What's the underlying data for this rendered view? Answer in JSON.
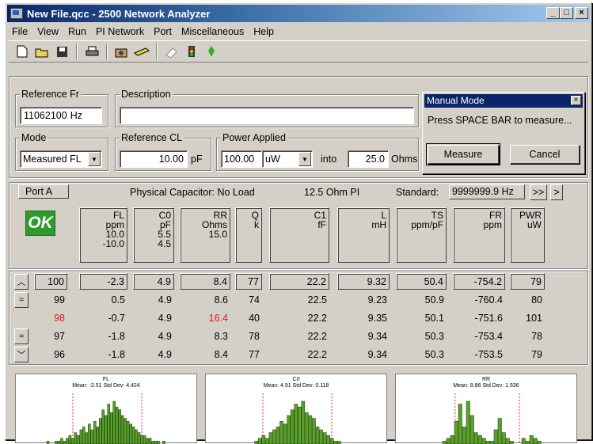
{
  "window": {
    "title": "New File.qcc - 2500 Network Analyzer",
    "buttons": {
      "min": "_",
      "max": "□",
      "close": "×"
    }
  },
  "menu": [
    "File",
    "View",
    "Run",
    "PI Network",
    "Port",
    "Miscellaneous",
    "Help"
  ],
  "toolbar": [
    "new-file-icon",
    "open-folder-icon",
    "save-icon",
    "print-icon",
    "camera-icon",
    "tape-icon",
    "eraser-icon",
    "traffic-light-icon",
    "pin-icon"
  ],
  "form": {
    "ref_freq_label": "Reference Fr",
    "ref_freq_value": "11062100",
    "ref_freq_unit": "Hz",
    "description_label": "Description",
    "description_value": "",
    "mode_label": "Mode",
    "mode_value": "Measured FL",
    "ref_cl_label": "Reference CL",
    "ref_cl_value": "10.00",
    "ref_cl_unit": "pF",
    "power_label": "Power Applied",
    "power_value": "100.00",
    "power_unit": "uW",
    "into_label": "into",
    "ohms_value": "25.0",
    "ohms_unit": "Ohms"
  },
  "manual": {
    "title": "Manual Mode",
    "message": "Press SPACE BAR to measure...",
    "measure": "Measure",
    "cancel": "Cancel",
    "close": "×"
  },
  "info": {
    "port": "Port A",
    "physical_cap": "Physical Capacitor: No Load",
    "pi": "12.5 Ohm PI",
    "standard_label": "Standard:",
    "standard_value": "9999999.9 Hz",
    "next_all": ">>",
    "next": ">"
  },
  "status": {
    "ok": "OK",
    "color": "#2e9a2e"
  },
  "headers": [
    {
      "name": "FL",
      "unit": "ppm",
      "l1": "10.0",
      "l2": "-10.0",
      "l3": ""
    },
    {
      "name": "C0",
      "unit": "pF",
      "l1": "5.5",
      "l2": "4.5",
      "l3": ""
    },
    {
      "name": "RR",
      "unit": "Ohms",
      "l1": "15.0",
      "l2": "",
      "l3": ""
    },
    {
      "name": "Q",
      "unit": "k",
      "l1": "",
      "l2": "",
      "l3": ""
    },
    {
      "name": "C1",
      "unit": "fF",
      "l1": "",
      "l2": "",
      "l3": ""
    },
    {
      "name": "L",
      "unit": "mH",
      "l1": "",
      "l2": "",
      "l3": ""
    },
    {
      "name": "TS",
      "unit": "ppm/pF",
      "l1": "",
      "l2": "",
      "l3": ""
    },
    {
      "name": "FR",
      "unit": "ppm",
      "l1": "",
      "l2": "",
      "l3": ""
    },
    {
      "name": "PWR",
      "unit": "uW",
      "l1": "",
      "l2": "",
      "l3": ""
    }
  ],
  "rows": [
    {
      "id": "100",
      "vals": [
        "-2.3",
        "4.9",
        "8.4",
        "77",
        "22.2",
        "9.32",
        "50.4",
        "-754.2",
        "79"
      ],
      "red_id": false,
      "red_col": -1
    },
    {
      "id": "99",
      "vals": [
        "0.5",
        "4.9",
        "8.6",
        "74",
        "22.5",
        "9.23",
        "50.9",
        "-760.4",
        "80"
      ],
      "red_id": false,
      "red_col": -1
    },
    {
      "id": "98",
      "vals": [
        "-0.7",
        "4.9",
        "16.4",
        "40",
        "22.2",
        "9.35",
        "50.1",
        "-751.6",
        "101"
      ],
      "red_id": true,
      "red_col": 2
    },
    {
      "id": "97",
      "vals": [
        "-1.8",
        "4.9",
        "8.3",
        "78",
        "22.2",
        "9.34",
        "50.3",
        "-753.4",
        "78"
      ],
      "red_id": false,
      "red_col": -1
    },
    {
      "id": "96",
      "vals": [
        "-1.8",
        "4.9",
        "8.4",
        "77",
        "22.2",
        "9.34",
        "50.3",
        "-753.5",
        "79"
      ],
      "red_id": false,
      "red_col": -1
    }
  ],
  "nav": [
    "up-icon",
    "double-up-icon",
    "double-down-icon",
    "down-icon"
  ],
  "charts": [
    {
      "title": "FL",
      "stats": "Mean: -2.51  Std Dev: 4.424",
      "bars": [
        1,
        0,
        0,
        1,
        1,
        2,
        1,
        2,
        3,
        2,
        4,
        3,
        5,
        6,
        4,
        7,
        5,
        8,
        6,
        9,
        12,
        10,
        14,
        11,
        15,
        13,
        12,
        10,
        9,
        8,
        7,
        6,
        5,
        4,
        3,
        3,
        2,
        2,
        1,
        1,
        1,
        0,
        1
      ]
    },
    {
      "title": "C0",
      "stats": "Mean: 4.91  Std Dev: 0.118",
      "bars": [
        0,
        0,
        0,
        0,
        0,
        1,
        2,
        3,
        2,
        4,
        5,
        6,
        8,
        7,
        10,
        12,
        14,
        13,
        15,
        11,
        10,
        9,
        6,
        5,
        4,
        3,
        2,
        1,
        1,
        0,
        0,
        0,
        0
      ]
    },
    {
      "title": "RR",
      "stats": "Mean: 8.86  Std Dev: 1.536",
      "bars": [
        0,
        0,
        0,
        1,
        2,
        3,
        8,
        14,
        6,
        15,
        10,
        4,
        3,
        2,
        1,
        1,
        5,
        9,
        4,
        2,
        1,
        0,
        0,
        2,
        1,
        3,
        2,
        1
      ]
    }
  ]
}
